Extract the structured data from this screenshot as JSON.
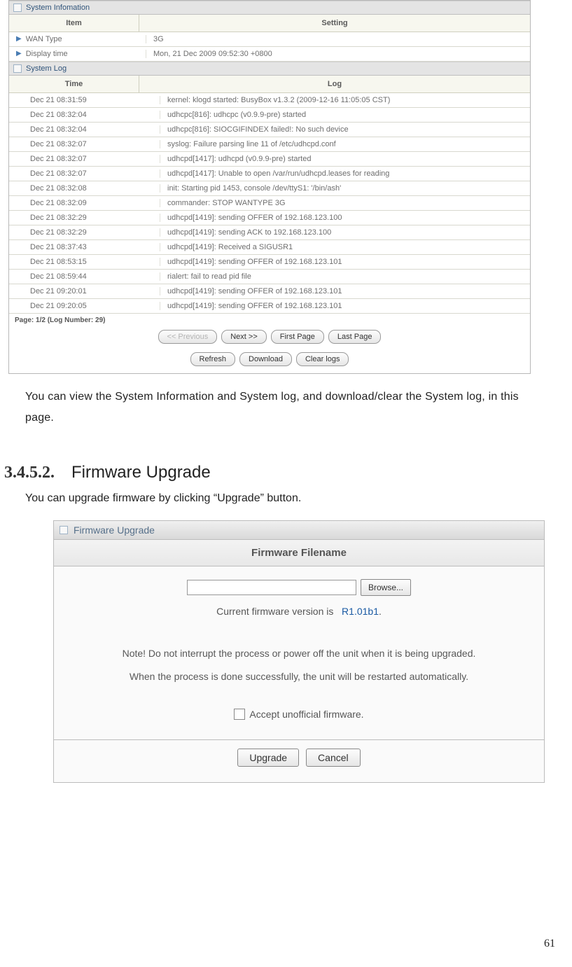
{
  "sysinfo": {
    "section_title": "System Infomation",
    "header_item": "Item",
    "header_setting": "Setting",
    "rows": [
      {
        "item": "WAN Type",
        "value": "3G"
      },
      {
        "item": "Display time",
        "value": "Mon, 21 Dec 2009 09:52:30 +0800"
      }
    ]
  },
  "syslog": {
    "section_title": "System Log",
    "header_time": "Time",
    "header_log": "Log",
    "entries": [
      {
        "t": "Dec 21 08:31:59",
        "m": "kernel: klogd started: BusyBox v1.3.2 (2009-12-16 11:05:05 CST)"
      },
      {
        "t": "Dec 21 08:32:04",
        "m": "udhcpc[816]: udhcpc (v0.9.9-pre) started"
      },
      {
        "t": "Dec 21 08:32:04",
        "m": "udhcpc[816]: SIOCGIFINDEX failed!: No such device"
      },
      {
        "t": "Dec 21 08:32:07",
        "m": "syslog: Failure parsing line 11 of /etc/udhcpd.conf"
      },
      {
        "t": "Dec 21 08:32:07",
        "m": "udhcpd[1417]: udhcpd (v0.9.9-pre) started"
      },
      {
        "t": "Dec 21 08:32:07",
        "m": "udhcpd[1417]: Unable to open /var/run/udhcpd.leases for reading"
      },
      {
        "t": "Dec 21 08:32:08",
        "m": "init: Starting pid 1453, console /dev/ttyS1: '/bin/ash'"
      },
      {
        "t": "Dec 21 08:32:09",
        "m": "commander: STOP WANTYPE 3G"
      },
      {
        "t": "Dec 21 08:32:29",
        "m": "udhcpd[1419]: sending OFFER of 192.168.123.100"
      },
      {
        "t": "Dec 21 08:32:29",
        "m": "udhcpd[1419]: sending ACK to 192.168.123.100"
      },
      {
        "t": "Dec 21 08:37:43",
        "m": "udhcpd[1419]: Received a SIGUSR1"
      },
      {
        "t": "Dec 21 08:53:15",
        "m": "udhcpd[1419]: sending OFFER of 192.168.123.101"
      },
      {
        "t": "Dec 21 08:59:44",
        "m": "rialert: fail to read pid file"
      },
      {
        "t": "Dec 21 09:20:01",
        "m": "udhcpd[1419]: sending OFFER of 192.168.123.101"
      },
      {
        "t": "Dec 21 09:20:05",
        "m": "udhcpd[1419]: sending OFFER of 192.168.123.101"
      }
    ],
    "page_info": "Page: 1/2 (Log Number: 29)",
    "buttons": {
      "prev": "<< Previous",
      "next": "Next >>",
      "first": "First Page",
      "last": "Last Page",
      "refresh": "Refresh",
      "download": "Download",
      "clear": "Clear logs"
    }
  },
  "doc": {
    "para1": "You can view the System Information and System log, and download/clear the System log, in this page.",
    "section_num": "3.4.5.2.",
    "section_title": "Firmware Upgrade",
    "para2": "You can upgrade firmware by clicking “Upgrade” button."
  },
  "fw": {
    "bar_title": "Firmware Upgrade",
    "header": "Firmware Filename",
    "browse": "Browse...",
    "current_label": "Current firmware version is",
    "current_version": "R1.01b1",
    "current_suffix": ".",
    "note1": "Note! Do not interrupt the process or power off the unit when it is being upgraded.",
    "note2": "When the process is done successfully, the unit will be restarted automatically.",
    "accept": "Accept unofficial firmware.",
    "upgrade": "Upgrade",
    "cancel": "Cancel"
  },
  "page_number": "61"
}
